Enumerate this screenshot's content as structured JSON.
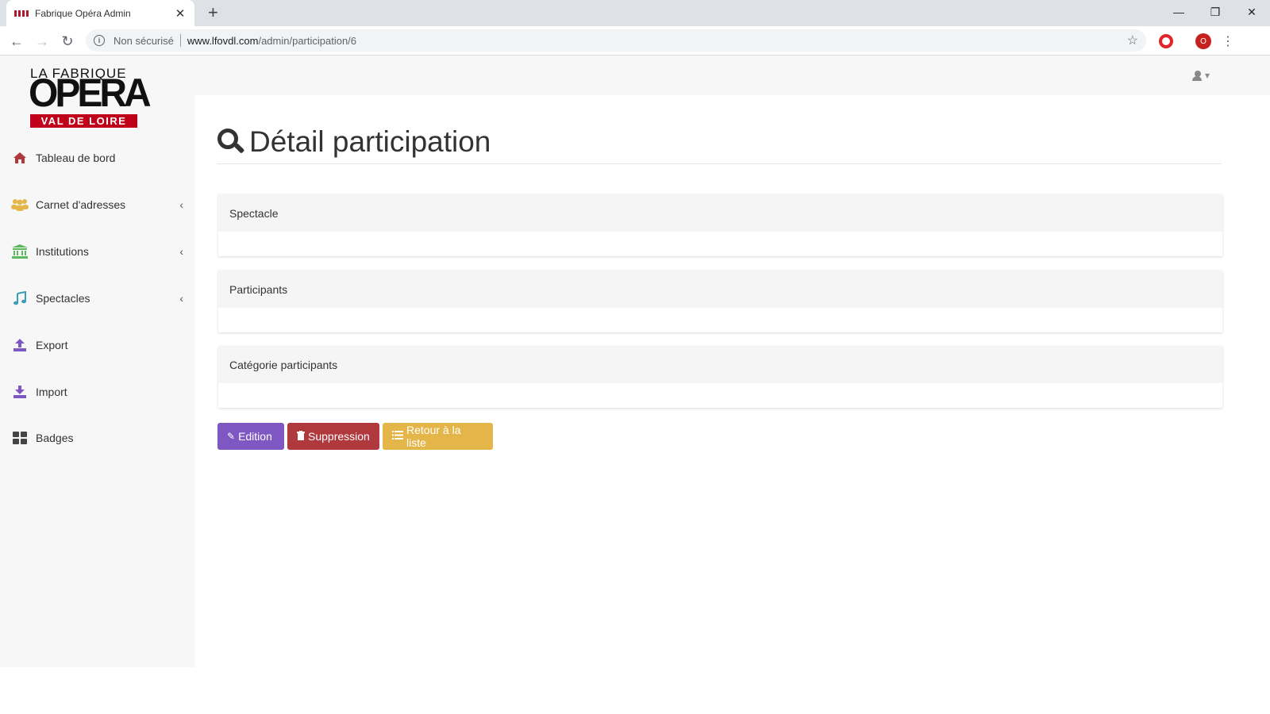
{
  "browser": {
    "tab_title": "Fabrique Opéra Admin",
    "tab_close": "✕",
    "new_tab": "+",
    "window_controls": {
      "minimize": "—",
      "restore": "❐",
      "close": "✕"
    },
    "nav": {
      "back": "←",
      "forward": "→",
      "reload": "↻"
    },
    "security_label": "Non sécurisé",
    "url_host": "www.lfovdl.com",
    "url_path": "/admin/participation/6",
    "bookmark": "☆",
    "profile_initial": "O",
    "menu": "⋮"
  },
  "logo": {
    "line1": "LA FABRIQUE",
    "line2": "OPERA",
    "line3": "VAL DE LOIRE",
    "color": "#c0001a"
  },
  "sidebar": {
    "items": [
      {
        "label": "Tableau de bord",
        "icon": "home-icon",
        "color": "#b0393d",
        "expandable": false
      },
      {
        "label": "Carnet d'adresses",
        "icon": "users-icon",
        "color": "#e4b548",
        "expandable": true
      },
      {
        "label": "Institutions",
        "icon": "institution-icon",
        "color": "#5cb85c",
        "expandable": true
      },
      {
        "label": "Spectacles",
        "icon": "music-icon",
        "color": "#3a9cb8",
        "expandable": true
      },
      {
        "label": "Export",
        "icon": "upload-icon",
        "color": "#7e57c2",
        "expandable": false
      },
      {
        "label": "Import",
        "icon": "download-icon",
        "color": "#7e57c2",
        "expandable": false
      },
      {
        "label": "Badges",
        "icon": "grid-icon",
        "color": "#444444",
        "expandable": false
      }
    ],
    "chevron": "‹"
  },
  "user_menu": {
    "icon": "user-icon",
    "caret": "▾"
  },
  "page": {
    "title": "Détail participation",
    "panels": [
      {
        "heading": "Spectacle"
      },
      {
        "heading": "Participants"
      },
      {
        "heading": "Catégorie participants"
      }
    ],
    "buttons": {
      "edit": {
        "label": "Edition",
        "icon": "✎",
        "color": "#7e57c2"
      },
      "delete": {
        "label": "Suppression",
        "icon": "🗑",
        "color": "#b0393d"
      },
      "back": {
        "label": "Retour à la liste",
        "icon": "≡",
        "color": "#e4b548"
      }
    }
  }
}
